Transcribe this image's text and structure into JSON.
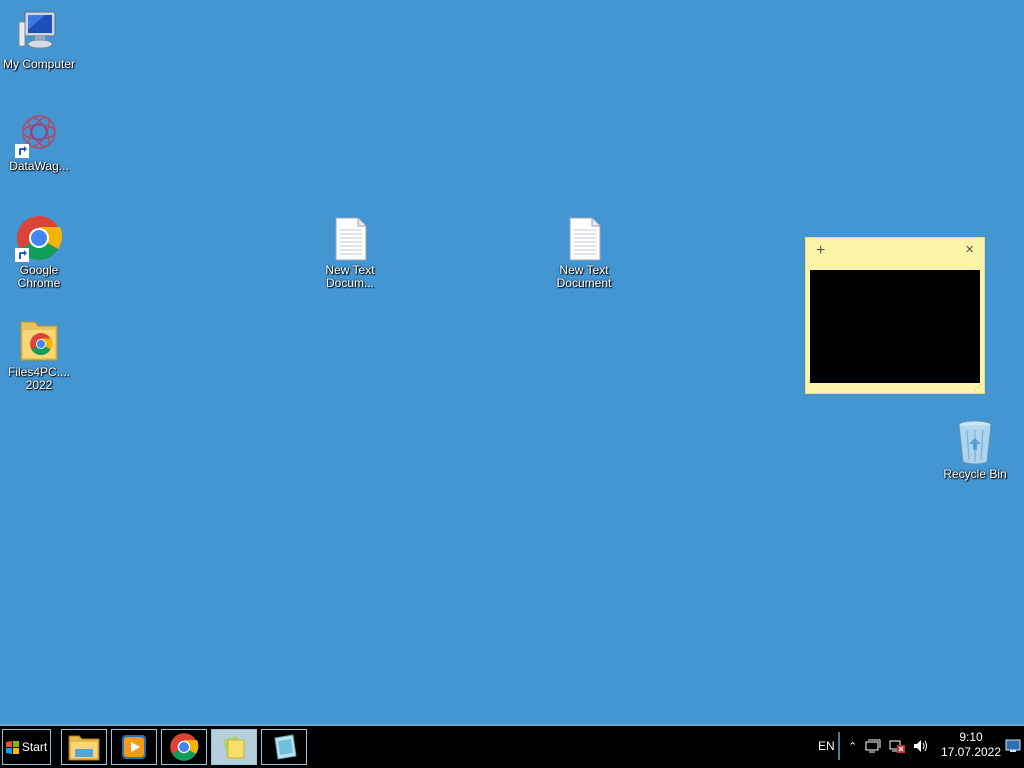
{
  "desktop": {
    "icons": [
      {
        "label": "My Computer"
      },
      {
        "label": "DataWag..."
      },
      {
        "label": "Google Chrome"
      },
      {
        "label": "Files4PC.... 2022"
      },
      {
        "label": "New Text Docum..."
      },
      {
        "label": "New Text Document"
      },
      {
        "label": "Recycle Bin"
      }
    ]
  },
  "sticky_note": {
    "add_glyph": "+",
    "close_glyph": "×"
  },
  "taskbar": {
    "start_label": "Start",
    "apps": [
      {
        "icon": "file-explorer-icon"
      },
      {
        "icon": "media-player-icon"
      },
      {
        "icon": "chrome-icon"
      },
      {
        "icon": "sticky-notes-icon",
        "active": true
      },
      {
        "icon": "snipping-tool-icon"
      }
    ],
    "language": "EN",
    "show_hidden_glyph": "⌃",
    "clock": {
      "time": "9:10",
      "date": "17.07.2022"
    }
  }
}
